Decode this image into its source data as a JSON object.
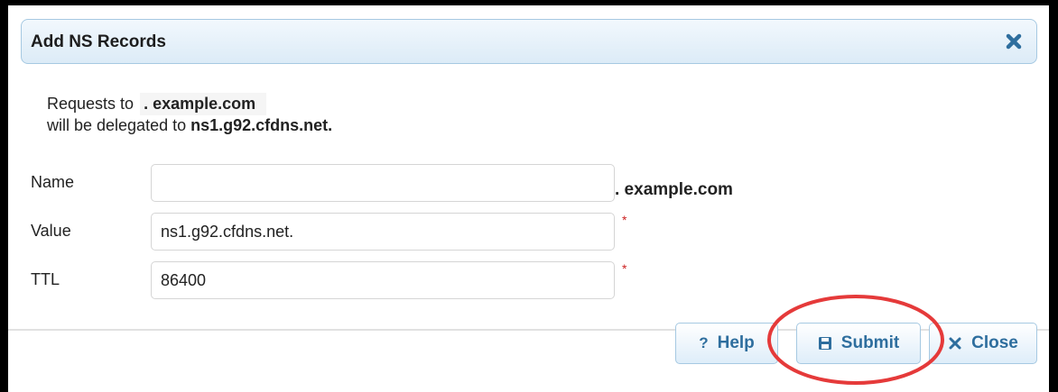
{
  "dialog": {
    "title": "Add NS Records",
    "close_icon": "close-x-icon"
  },
  "message": {
    "line1_prefix": "Requests to",
    "line1_domain": ". example.com",
    "line2_prefix": "will be delegated to",
    "line2_target": "ns1.g92.cfdns.net."
  },
  "form": {
    "name": {
      "label": "Name",
      "value": "",
      "suffix": ". example.com"
    },
    "value": {
      "label": "Value",
      "value": "ns1.g92.cfdns.net.",
      "required_mark": "*"
    },
    "ttl": {
      "label": "TTL",
      "value": "86400",
      "required_mark": "*"
    }
  },
  "buttons": {
    "help": {
      "label": "Help",
      "icon": "?"
    },
    "submit": {
      "label": "Submit",
      "icon": "save-icon"
    },
    "close": {
      "label": "Close",
      "icon": "close-x-icon"
    }
  },
  "colors": {
    "title_bar_border": "#a6c9e2",
    "button_text": "#2e6e9e",
    "required_mark": "#cc2222",
    "annotation_circle": "#e53a3a"
  }
}
